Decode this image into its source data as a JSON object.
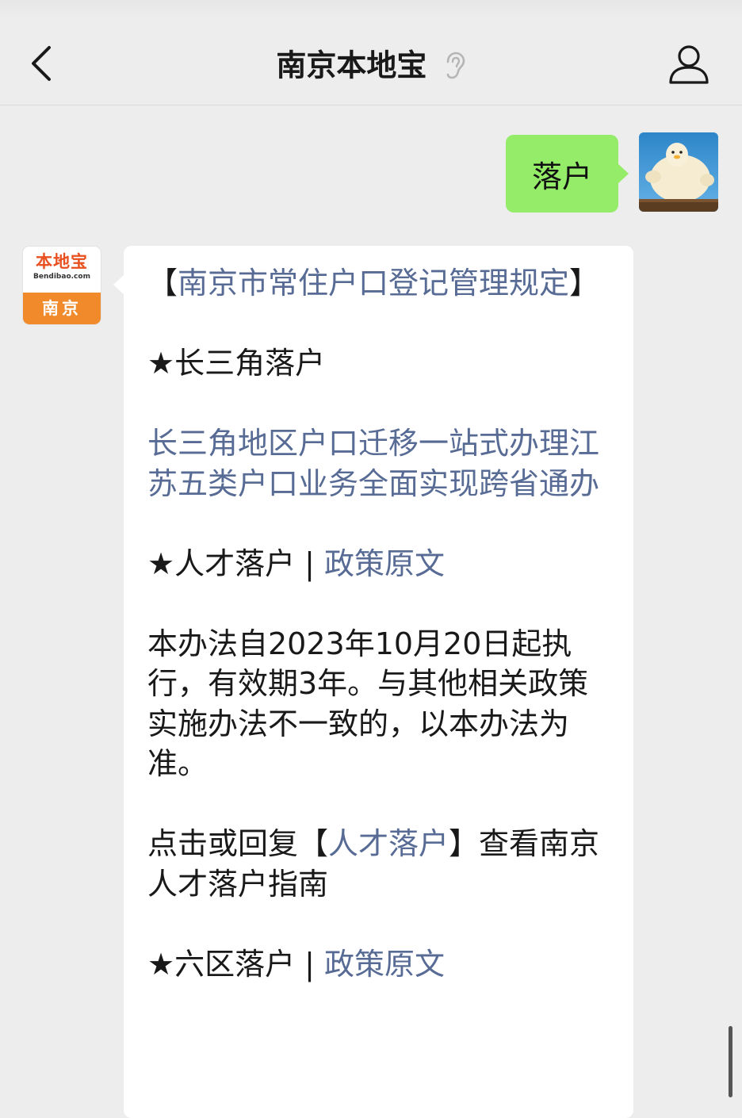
{
  "header": {
    "title": "南京本地宝"
  },
  "user_message": {
    "text": "落户"
  },
  "bot": {
    "avatar": {
      "logo_text": "本地宝",
      "logo_url": "Bendibao.com",
      "city": "南京"
    },
    "p1": {
      "open": "【",
      "link": "南京市常住户口登记管理规定",
      "close": "】"
    },
    "p2": {
      "text": "★长三角落户"
    },
    "p3": {
      "link": "长三角地区户口迁移一站式办理江苏五类户口业务全面实现跨省通办"
    },
    "p4": {
      "text": "★人才落户 | ",
      "link": "政策原文"
    },
    "p5": {
      "text": "本办法自2023年10月20日起执行，有效期3年。与其他相关政策实施办法不一致的，以本办法为准。"
    },
    "p6": {
      "before": "点击或回复【",
      "link": "人才落户",
      "after": "】查看南京人才落户指南"
    },
    "p7": {
      "text": "★六区落户 | ",
      "link": "政策原文"
    }
  }
}
